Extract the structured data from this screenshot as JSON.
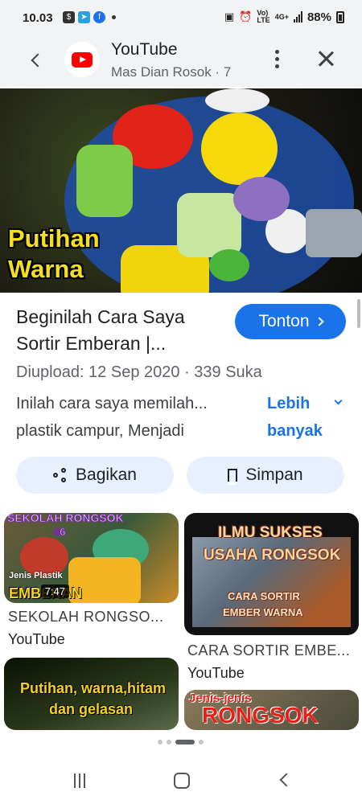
{
  "status_bar": {
    "time": "10.03",
    "net_top": "Vo)",
    "net_mid": "LTE",
    "net_type": "4G+",
    "battery": "88%"
  },
  "header": {
    "title": "YouTube",
    "subtitle": "Mas Dian Rosok · 7"
  },
  "video": {
    "thumbnail_caption_line1": "Putihan",
    "thumbnail_caption_line2": "Warna",
    "title": "Beginilah Cara Saya Sortir Emberan |...",
    "watch_label": "Tonton",
    "meta": "Diupload: 12 Sep 2020 · 339 Suka",
    "description": "Inilah cara saya memilah... plastik campur, Menjadi",
    "more_label": "Lebih banyak",
    "share_label": "Bagikan",
    "save_label": "Simpan"
  },
  "related": [
    {
      "thumb_text_top": "SEKOLAH RONGSOK",
      "thumb_text_num": "#6",
      "thumb_text_small": "Jenis Plastik",
      "thumb_text_big": "EMBERAN",
      "duration": "7:47",
      "title": "SEKOLAH RONGSO...",
      "channel": "YouTube"
    },
    {
      "thumb_text_1": "ILMU SUKSES",
      "thumb_text_2": "USAHA RONGSOK",
      "thumb_text_3": "CARA SORTIR",
      "thumb_text_4": "EMBER WARNA",
      "title": "CARA SORTIR EMBE...",
      "channel": "YouTube"
    },
    {
      "thumb_text_1": "Putihan, warna,hitam",
      "thumb_text_2": "dan gelasan"
    },
    {
      "thumb_text_1": "Jenis-jenis",
      "thumb_text_2": "RONGSOK"
    }
  ],
  "colors": {
    "accent": "#1a73e8",
    "pill_bg": "#e8f0fe",
    "header_bg": "#f1f3f4",
    "caption_yellow": "#f5e020"
  },
  "icons": [
    "back-chevron-icon",
    "youtube-logo-icon",
    "more-vert-icon",
    "close-icon",
    "chevron-right-icon",
    "chevron-down-icon",
    "share-icon",
    "bookmark-icon",
    "recents-icon",
    "home-icon",
    "nav-back-icon"
  ]
}
